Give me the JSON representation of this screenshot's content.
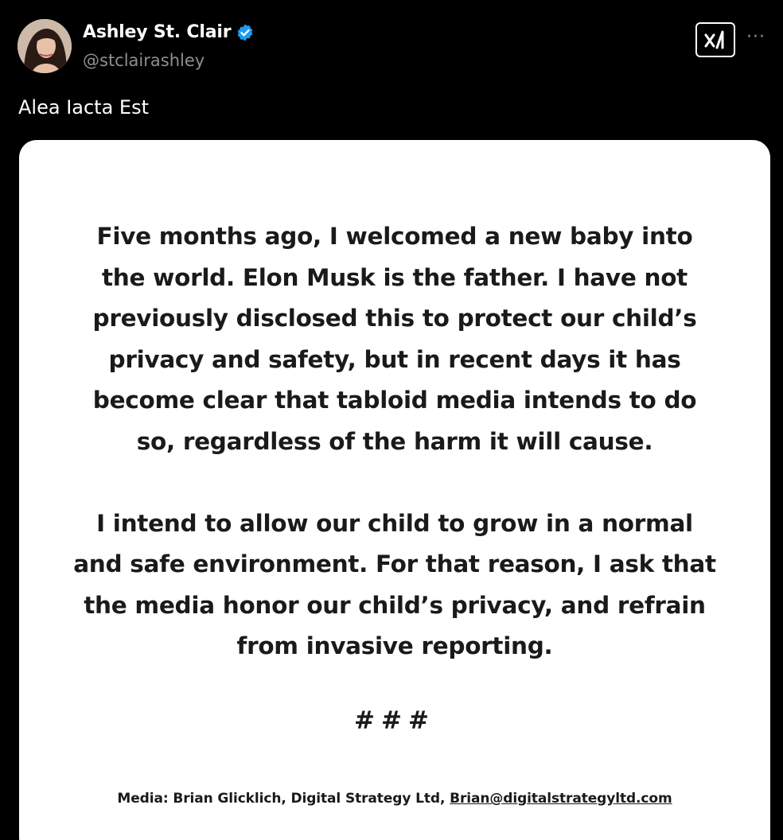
{
  "author": {
    "display_name": "Ashley St. Clair",
    "handle": "@stclairashley",
    "verified": true,
    "verified_color": "#1d9bf0"
  },
  "header": {
    "grok_icon": "grok-icon",
    "more_icon": "more-horizontal-icon",
    "more_glyph": "···"
  },
  "tweet": {
    "text": "Alea Iacta Est"
  },
  "image_card": {
    "paragraph_1": [
      "Five months ago, I welcomed a new baby into",
      "the world. Elon Musk is the father. I have not",
      "previously disclosed this to protect our child’s",
      "privacy and safety, but in recent days it has",
      "become clear that tabloid media intends to do",
      "so, regardless of the harm it will cause."
    ],
    "paragraph_2": [
      "I intend to allow our child to grow in a normal",
      "and safe environment. For that reason, I ask that",
      "the media honor our child’s privacy, and refrain",
      "from invasive reporting."
    ],
    "separator": "###",
    "media_contact_prefix": "Media: Brian Glicklich, Digital Strategy Ltd,",
    "media_contact_email": "Brian@digitalstrategyltd.com"
  },
  "colors": {
    "background": "#000000",
    "card": "#ffffff",
    "handle_gray": "#8b8f94"
  }
}
